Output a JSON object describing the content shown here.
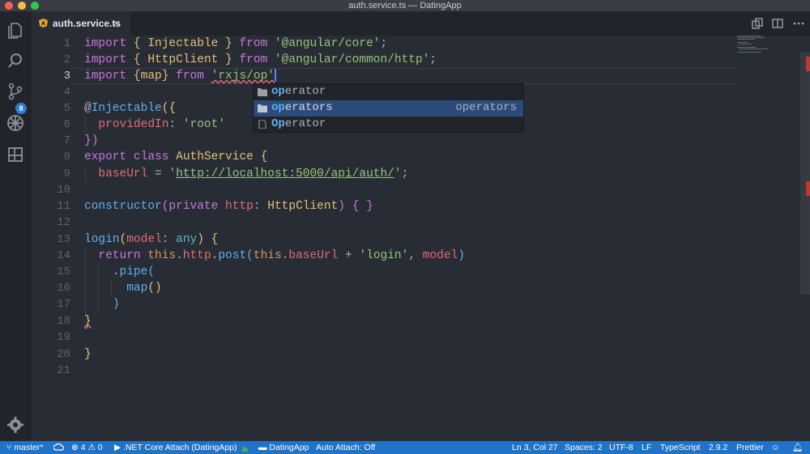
{
  "window": {
    "title": "auth.service.ts — DatingApp"
  },
  "activity_bar": {
    "source_control_badge": "8"
  },
  "tab": {
    "label": "auth.service.ts",
    "close": "×"
  },
  "editor": {
    "line_numbers": [
      "1",
      "2",
      "3",
      "4",
      "5",
      "6",
      "7",
      "8",
      "9",
      "10",
      "11",
      "12",
      "13",
      "14",
      "15",
      "16",
      "17",
      "18",
      "19",
      "20",
      "21"
    ],
    "line1": {
      "kw1": "import",
      "open": "{",
      "name": "Injectable",
      "close": "}",
      "kw2": "from",
      "str": "'@angular/core'",
      "end": ";"
    },
    "line2": {
      "kw1": "import",
      "open": "{",
      "name": "HttpClient",
      "close": "}",
      "kw2": "from",
      "str": "'@angular/common/http'",
      "end": ";"
    },
    "line3": {
      "kw1": "import",
      "open": "{",
      "name": "map",
      "close": "}",
      "kw2": "from",
      "str": "'rxjs/op'"
    },
    "line5": {
      "at": "@",
      "decorator": "Injectable",
      "rest": "({"
    },
    "line6": {
      "prop": "providedIn",
      "colon": ":",
      "str": "'root'"
    },
    "line7": {
      "text": "})"
    },
    "line8": {
      "kw1": "export",
      "kw2": "class",
      "name": "AuthService",
      "brace": "{"
    },
    "line9": {
      "prop": "baseUrl",
      "eq": "=",
      "str_q1": "'",
      "url": "http://localhost:5000/api/auth/",
      "str_q2": "'",
      "end": ";"
    },
    "line11": {
      "fn": "constructor",
      "open": "(",
      "kw": "private",
      "param": "http",
      "colon": ":",
      "type": "HttpClient",
      "close": ")",
      "body": "{ }"
    },
    "line13": {
      "fn": "login",
      "open": "(",
      "param": "model",
      "colon": ":",
      "type": "any",
      "close": ")",
      "brace": "{"
    },
    "line14": {
      "kw": "return",
      "this1": "this",
      "dot1": ".",
      "prop1": "http",
      "dot2": ".",
      "method": "post",
      "open": "(",
      "this2": "this",
      "dot3": ".",
      "prop2": "baseUrl",
      "plus": "+",
      "str": "'login'",
      "comma": ",",
      "arg": "model",
      "close": ")"
    },
    "line15": {
      "dot": ".",
      "method": "pipe",
      "open": "("
    },
    "line16": {
      "fn": "map",
      "parens": "()"
    },
    "line17": {
      "text": ")"
    },
    "line18": {
      "text": "}"
    },
    "line20": {
      "text": "}"
    }
  },
  "suggestions": [
    {
      "match": "op",
      "rest": "erator",
      "detail": "",
      "icon": "folder-icon"
    },
    {
      "match": "op",
      "rest": "erators",
      "detail": "operators",
      "icon": "folder-icon"
    },
    {
      "match": "Op",
      "rest": "erator",
      "detail": "",
      "icon": "file-icon"
    }
  ],
  "statusbar": {
    "branch": "master*",
    "errors": "4",
    "warnings": "0",
    "debug": ".NET Core Attach (DatingApp)",
    "folder": "DatingApp",
    "auto_attach": "Auto Attach: Off",
    "position": "Ln 3, Col 27",
    "spaces": "Spaces: 2",
    "encoding": "UTF-8",
    "eol": "LF",
    "language": "TypeScript",
    "version": "2.9.2",
    "formatter": "Prettier"
  },
  "colors": {
    "accent": "#1f73c8",
    "editor_bg": "#282c34",
    "selection": "#2c4a7a"
  }
}
